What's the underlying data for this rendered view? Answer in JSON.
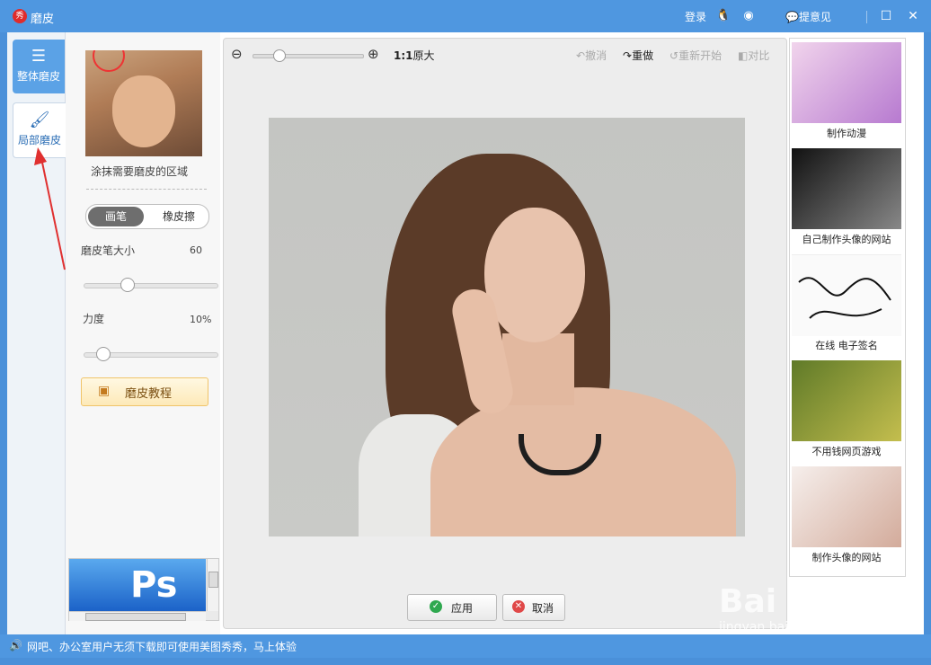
{
  "window": {
    "title": "磨皮",
    "logo": "秀",
    "login": "登录",
    "feedback": "提意见"
  },
  "left_tabs": [
    {
      "label": "整体磨皮",
      "icon": "sliders-icon"
    },
    {
      "label": "局部磨皮",
      "icon": "brush-icon"
    }
  ],
  "panel": {
    "hint": "涂抹需要磨皮的区域",
    "mode": {
      "brush": "画笔",
      "eraser": "橡皮擦"
    },
    "brush_size": {
      "label": "磨皮笔大小",
      "value": "60",
      "level": 0.3
    },
    "strength": {
      "label": "力度",
      "value": "10%",
      "level": 0.1
    },
    "tutorial": "磨皮教程",
    "ad_text": "Ps"
  },
  "toolbar": {
    "ratio": "1:1",
    "ratio_suffix": "原大",
    "undo": "撤消",
    "redo": "重做",
    "restart": "重新开始",
    "compare": "对比"
  },
  "actions": {
    "apply": "应用",
    "cancel": "取消"
  },
  "side_ads": [
    {
      "caption": "制作动漫",
      "colors": [
        "#e7c8e6",
        "#b77ad0"
      ]
    },
    {
      "caption": "自己制作头像的网站",
      "colors": [
        "#1a1a1a",
        "#888"
      ]
    },
    {
      "caption": "在线 电子签名",
      "colors": [
        "#ffffff",
        "#f4f4f4"
      ]
    },
    {
      "caption": "不用钱网页游戏",
      "colors": [
        "#6f8a32",
        "#b6b34a"
      ]
    },
    {
      "caption": "制作头像的网站",
      "colors": [
        "#f3ecea",
        "#d8b6a8"
      ]
    }
  ],
  "status": {
    "message": "网吧、办公室用户无须下载即可使用美图秀秀，马上体验"
  },
  "watermark": {
    "brand": "Bai 经验",
    "url": "jingyan.baidu.com"
  }
}
